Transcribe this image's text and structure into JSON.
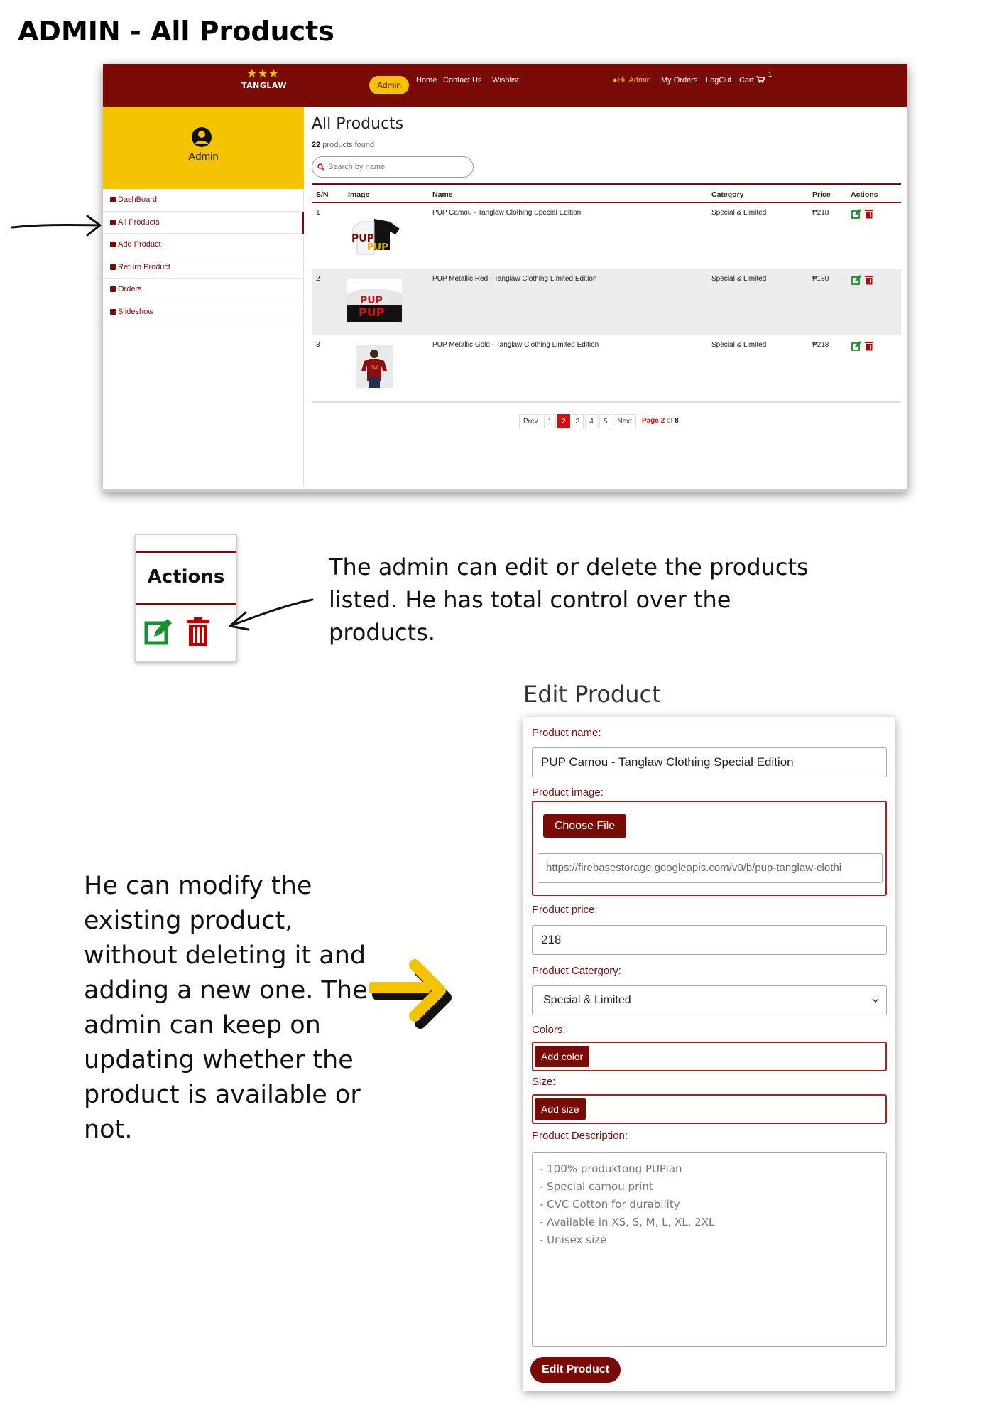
{
  "page_heading": "ADMIN - All Products",
  "screenshot": {
    "navbar": {
      "logo_text": "TANGLAW",
      "admin_pill": "Admin",
      "links": [
        "Home",
        "Contact Us",
        "Wishlist"
      ],
      "greeting": "Hi, Admin",
      "my_orders": "My Orders",
      "logout": "LogOut",
      "cart": "Cart",
      "cart_count": "1",
      "colors": {
        "maroon": "#7a0a06",
        "gold": "#f3c300"
      }
    },
    "sidebar": {
      "user_label": "Admin",
      "items": [
        {
          "label": "DashBoard",
          "icon": "dashboard-icon"
        },
        {
          "label": "All Products",
          "icon": "products-icon",
          "active": true
        },
        {
          "label": "Add Product",
          "icon": "add-product-icon"
        },
        {
          "label": "Return Product",
          "icon": "return-icon"
        },
        {
          "label": "Orders",
          "icon": "orders-icon"
        },
        {
          "label": "Slideshow",
          "icon": "slideshow-icon"
        }
      ]
    },
    "main": {
      "title": "All Products",
      "count": "22",
      "count_suffix": " products found",
      "search_placeholder": "Search by name",
      "columns": [
        "S/N",
        "Image",
        "Name",
        "Category",
        "Price",
        "Actions"
      ],
      "rows": [
        {
          "sn": "1",
          "name": "PUP Camou - Tanglaw Clothing Special Edition",
          "category": "Special & Limited",
          "price": "₱218"
        },
        {
          "sn": "2",
          "name": "PUP Metallic Red - Tanglaw Clothing Limited Edition",
          "category": "Special & Limited",
          "price": "₱180"
        },
        {
          "sn": "3",
          "name": "PUP Metallic Gold - Tanglaw Clothing Limited Edition",
          "category": "Special & Limited",
          "price": "₱218"
        }
      ],
      "pagination": {
        "prev": "Prev",
        "pages": [
          "1",
          "2",
          "3",
          "4",
          "5"
        ],
        "current": "2",
        "next": "Next",
        "info_page": "Page 2",
        "info_of": " of ",
        "info_total": "8"
      }
    }
  },
  "actions_zoom": {
    "header": "Actions"
  },
  "caption_actions": "The admin can edit or delete the products listed. He has total control over the products.",
  "edit_form": {
    "title": "Edit Product",
    "name_label": "Product name:",
    "name_value": "PUP Camou - Tanglaw Clothing Special Edition",
    "image_label": "Product image:",
    "choose_file": "Choose File",
    "image_url": "https://firebasestorage.googleapis.com/v0/b/pup-tanglaw-clothi",
    "price_label": "Product price:",
    "price_value": "218",
    "category_label": "Product Catergory:",
    "category_value": "Special & Limited",
    "colors_label": "Colors:",
    "add_color": "Add color",
    "size_label": "Size:",
    "add_size": "Add size",
    "desc_label": "Product Description:",
    "desc_lines": [
      "- 100% produktong PUPian",
      "- Special camou print",
      "- CVC Cotton for durability",
      "- Available in XS, S, M, L, XL, 2XL",
      "- Unisex size"
    ],
    "submit": "Edit Product"
  },
  "caption_edit": "He can modify the existing product, without deleting it and adding a new one. The admin can keep on updating whether the product is available or not."
}
